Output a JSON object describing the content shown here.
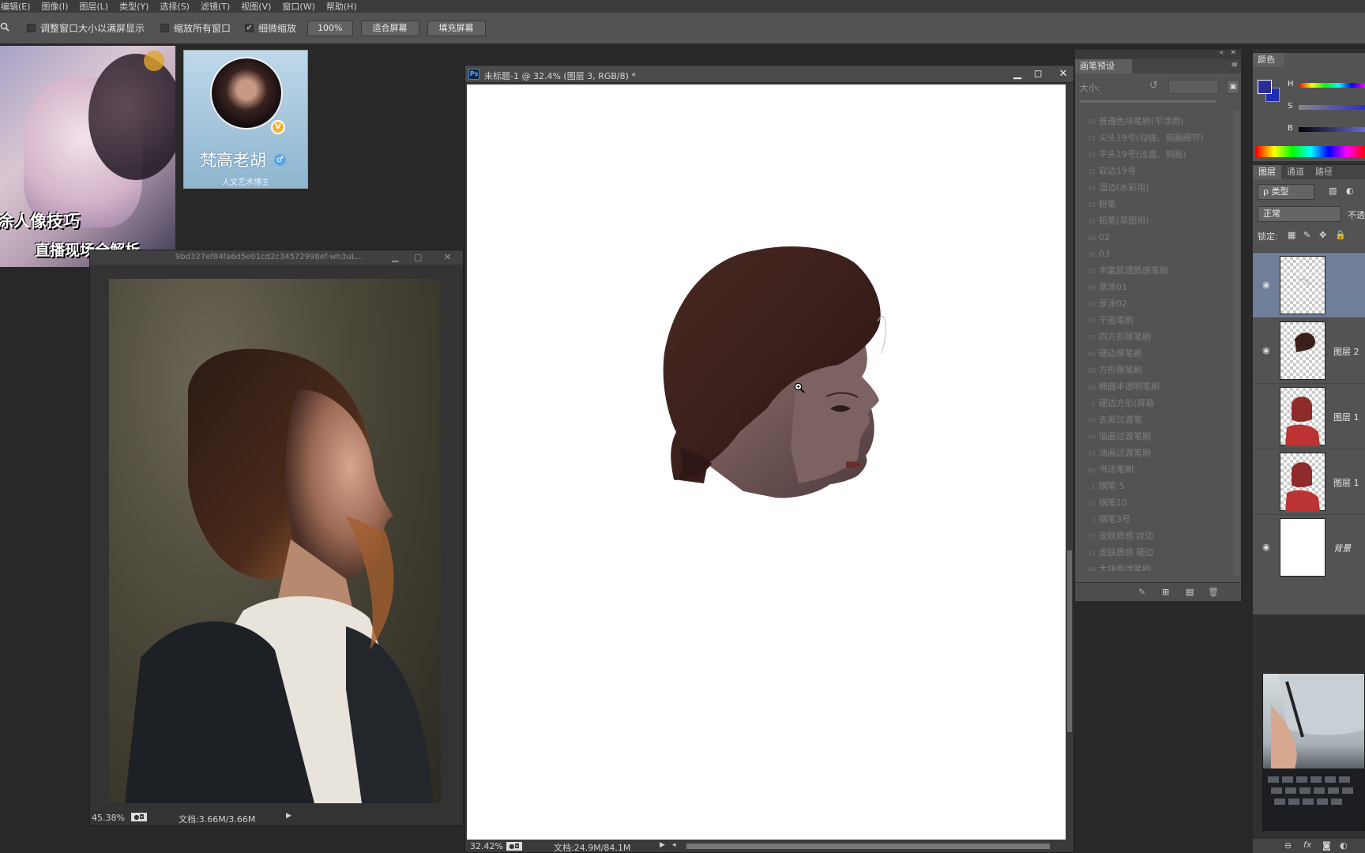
{
  "menu": [
    "编辑(E)",
    "图像(I)",
    "图层(L)",
    "类型(Y)",
    "选择(S)",
    "滤镜(T)",
    "视图(V)",
    "窗口(W)",
    "帮助(H)"
  ],
  "options": {
    "resize_windows": "调整窗口大小以满屏显示",
    "zoom_all": "缩放所有窗口",
    "scrubby_zoom": "细微缩放",
    "btn_100": "100%",
    "btn_fit": "适合屏幕",
    "btn_fill": "填充屏幕"
  },
  "overlay": {
    "line1": "涂人像技巧",
    "line2": "直播现场全解析",
    "profile_name": "梵高老胡",
    "profile_sub": "人文艺术博主",
    "badge": "V",
    "gender": "♂"
  },
  "reference_window": {
    "title": "9bd327ef84fa6d5e01cd2c34572998ef-wh3uL...",
    "zoom": "45.38%",
    "doc_info": "文档:3.66M/3.66M"
  },
  "document": {
    "title": "未标题-1 @ 32.4% (图层 3, RGB/8) *",
    "zoom": "32.42%",
    "doc_info": "文档:24.9M/84.1M"
  },
  "brush_panel": {
    "tab": "画笔预设",
    "size_label": "大小:",
    "items": [
      {
        "n": "56",
        "label": "普通色块笔刷(平涂用)"
      },
      {
        "n": "21",
        "label": "尖头19号(勾线、刻画细节)"
      },
      {
        "n": "29",
        "label": "平头19号(过渡、刻画)"
      },
      {
        "n": "31",
        "label": "软边19号"
      },
      {
        "n": "64",
        "label": "湿边(水彩用)"
      },
      {
        "n": "30",
        "label": "粉笔"
      },
      {
        "n": "36",
        "label": "铅笔(草图用)"
      },
      {
        "n": "90",
        "label": "02"
      },
      {
        "n": "36",
        "label": "03"
      },
      {
        "n": "25",
        "label": "丰富肌理质感笔刷"
      },
      {
        "n": "60",
        "label": "厚涂01"
      },
      {
        "n": "60",
        "label": "厚涂02"
      },
      {
        "n": "70",
        "label": "干画笔刷"
      },
      {
        "n": "70",
        "label": "四方形厚笔刷"
      },
      {
        "n": "40",
        "label": "硬边厚笔刷"
      },
      {
        "n": "60",
        "label": "方形厚笔刷"
      },
      {
        "n": "60",
        "label": "椭圆半透明笔刷"
      },
      {
        "n": "1",
        "label": "硬边方形(屏幕"
      },
      {
        "n": "60",
        "label": "去黑过渡笔"
      },
      {
        "n": "40",
        "label": "油画过渡笔刷"
      },
      {
        "n": "40",
        "label": "油画过渡笔刷"
      },
      {
        "n": "80",
        "label": "书法笔刷"
      },
      {
        "n": "1",
        "label": "钢笔 5"
      },
      {
        "n": "10",
        "label": "钢笔10"
      },
      {
        "n": "3",
        "label": "钢笔3号"
      },
      {
        "n": "17",
        "label": "皮肤质感 纹边"
      },
      {
        "n": "11",
        "label": "皮肤质感 硬边"
      },
      {
        "n": "40",
        "label": "大块面涂笔刷"
      }
    ]
  },
  "color_panel": {
    "tab": "颜色",
    "h": "H",
    "s": "S",
    "b": "B",
    "fg_color": "#2b2b9a",
    "bg_color": "#1d2db0"
  },
  "layers_panel": {
    "tabs": [
      "图层",
      "通道",
      "路径"
    ],
    "filter": "ρ 类型",
    "blend": "正常",
    "opacity_label": "不透",
    "lock_label": "锁定:",
    "layers": [
      {
        "name": "",
        "visible": true,
        "active": true
      },
      {
        "name": "图层 2",
        "visible": true,
        "active": false
      },
      {
        "name": "图层 1",
        "visible": false,
        "active": false
      },
      {
        "name": "图层 1",
        "visible": false,
        "active": false
      },
      {
        "name": "背景",
        "visible": true,
        "active": false
      }
    ]
  }
}
